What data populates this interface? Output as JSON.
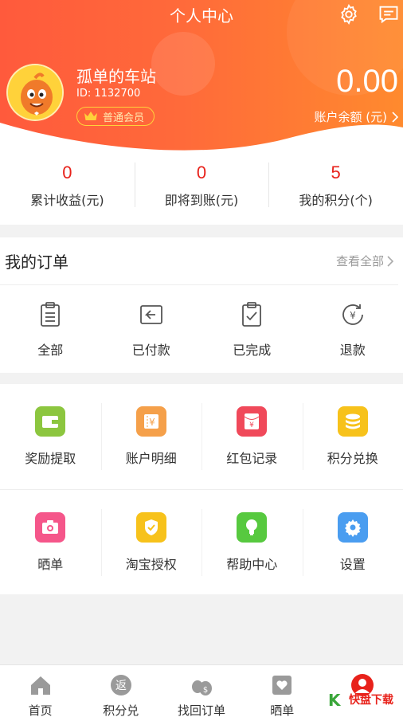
{
  "header": {
    "title": "个人中心",
    "user_name": "孤单的车站",
    "user_id": "ID: 1132700",
    "member_level": "普通会员",
    "balance": "0.00",
    "balance_label": "账户余额 (元)"
  },
  "stats": [
    {
      "value": "0",
      "label": "累计收益(元)"
    },
    {
      "value": "0",
      "label": "即将到账(元)"
    },
    {
      "value": "5",
      "label": "我的积分(个)"
    }
  ],
  "orders": {
    "title": "我的订单",
    "view_all": "查看全部",
    "items": [
      {
        "label": "全部",
        "icon": "clipboard-icon"
      },
      {
        "label": "已付款",
        "icon": "paid-icon"
      },
      {
        "label": "已完成",
        "icon": "check-clipboard-icon"
      },
      {
        "label": "退款",
        "icon": "refund-icon"
      }
    ]
  },
  "grid": {
    "row1": [
      {
        "label": "奖励提取",
        "icon": "wallet-icon",
        "color": "#8cc63f"
      },
      {
        "label": "账户明细",
        "icon": "ticket-icon",
        "color": "#f5a04a"
      },
      {
        "label": "红包记录",
        "icon": "red-envelope-icon",
        "color": "#f0495a"
      },
      {
        "label": "积分兑换",
        "icon": "coins-icon",
        "color": "#f7c21b"
      }
    ],
    "row2": [
      {
        "label": "晒单",
        "icon": "camera-icon",
        "color": "#f5568a"
      },
      {
        "label": "淘宝授权",
        "icon": "shield-check-icon",
        "color": "#f7c21b"
      },
      {
        "label": "帮助中心",
        "icon": "bulb-icon",
        "color": "#57c93f"
      },
      {
        "label": "设置",
        "icon": "gear-icon",
        "color": "#4a9df0"
      }
    ]
  },
  "nav": [
    {
      "label": "首页",
      "icon": "home-icon"
    },
    {
      "label": "积分兑",
      "icon": "return-icon",
      "glyph": "返"
    },
    {
      "label": "找回订单",
      "icon": "money-bags-icon"
    },
    {
      "label": "晒单",
      "icon": "heart-box-icon"
    },
    {
      "label": "",
      "icon": "profile-icon"
    }
  ],
  "watermark": {
    "brand": "快盘下载"
  },
  "colors": {
    "accent": "#ff5a3c",
    "red_number": "#e8221b"
  }
}
